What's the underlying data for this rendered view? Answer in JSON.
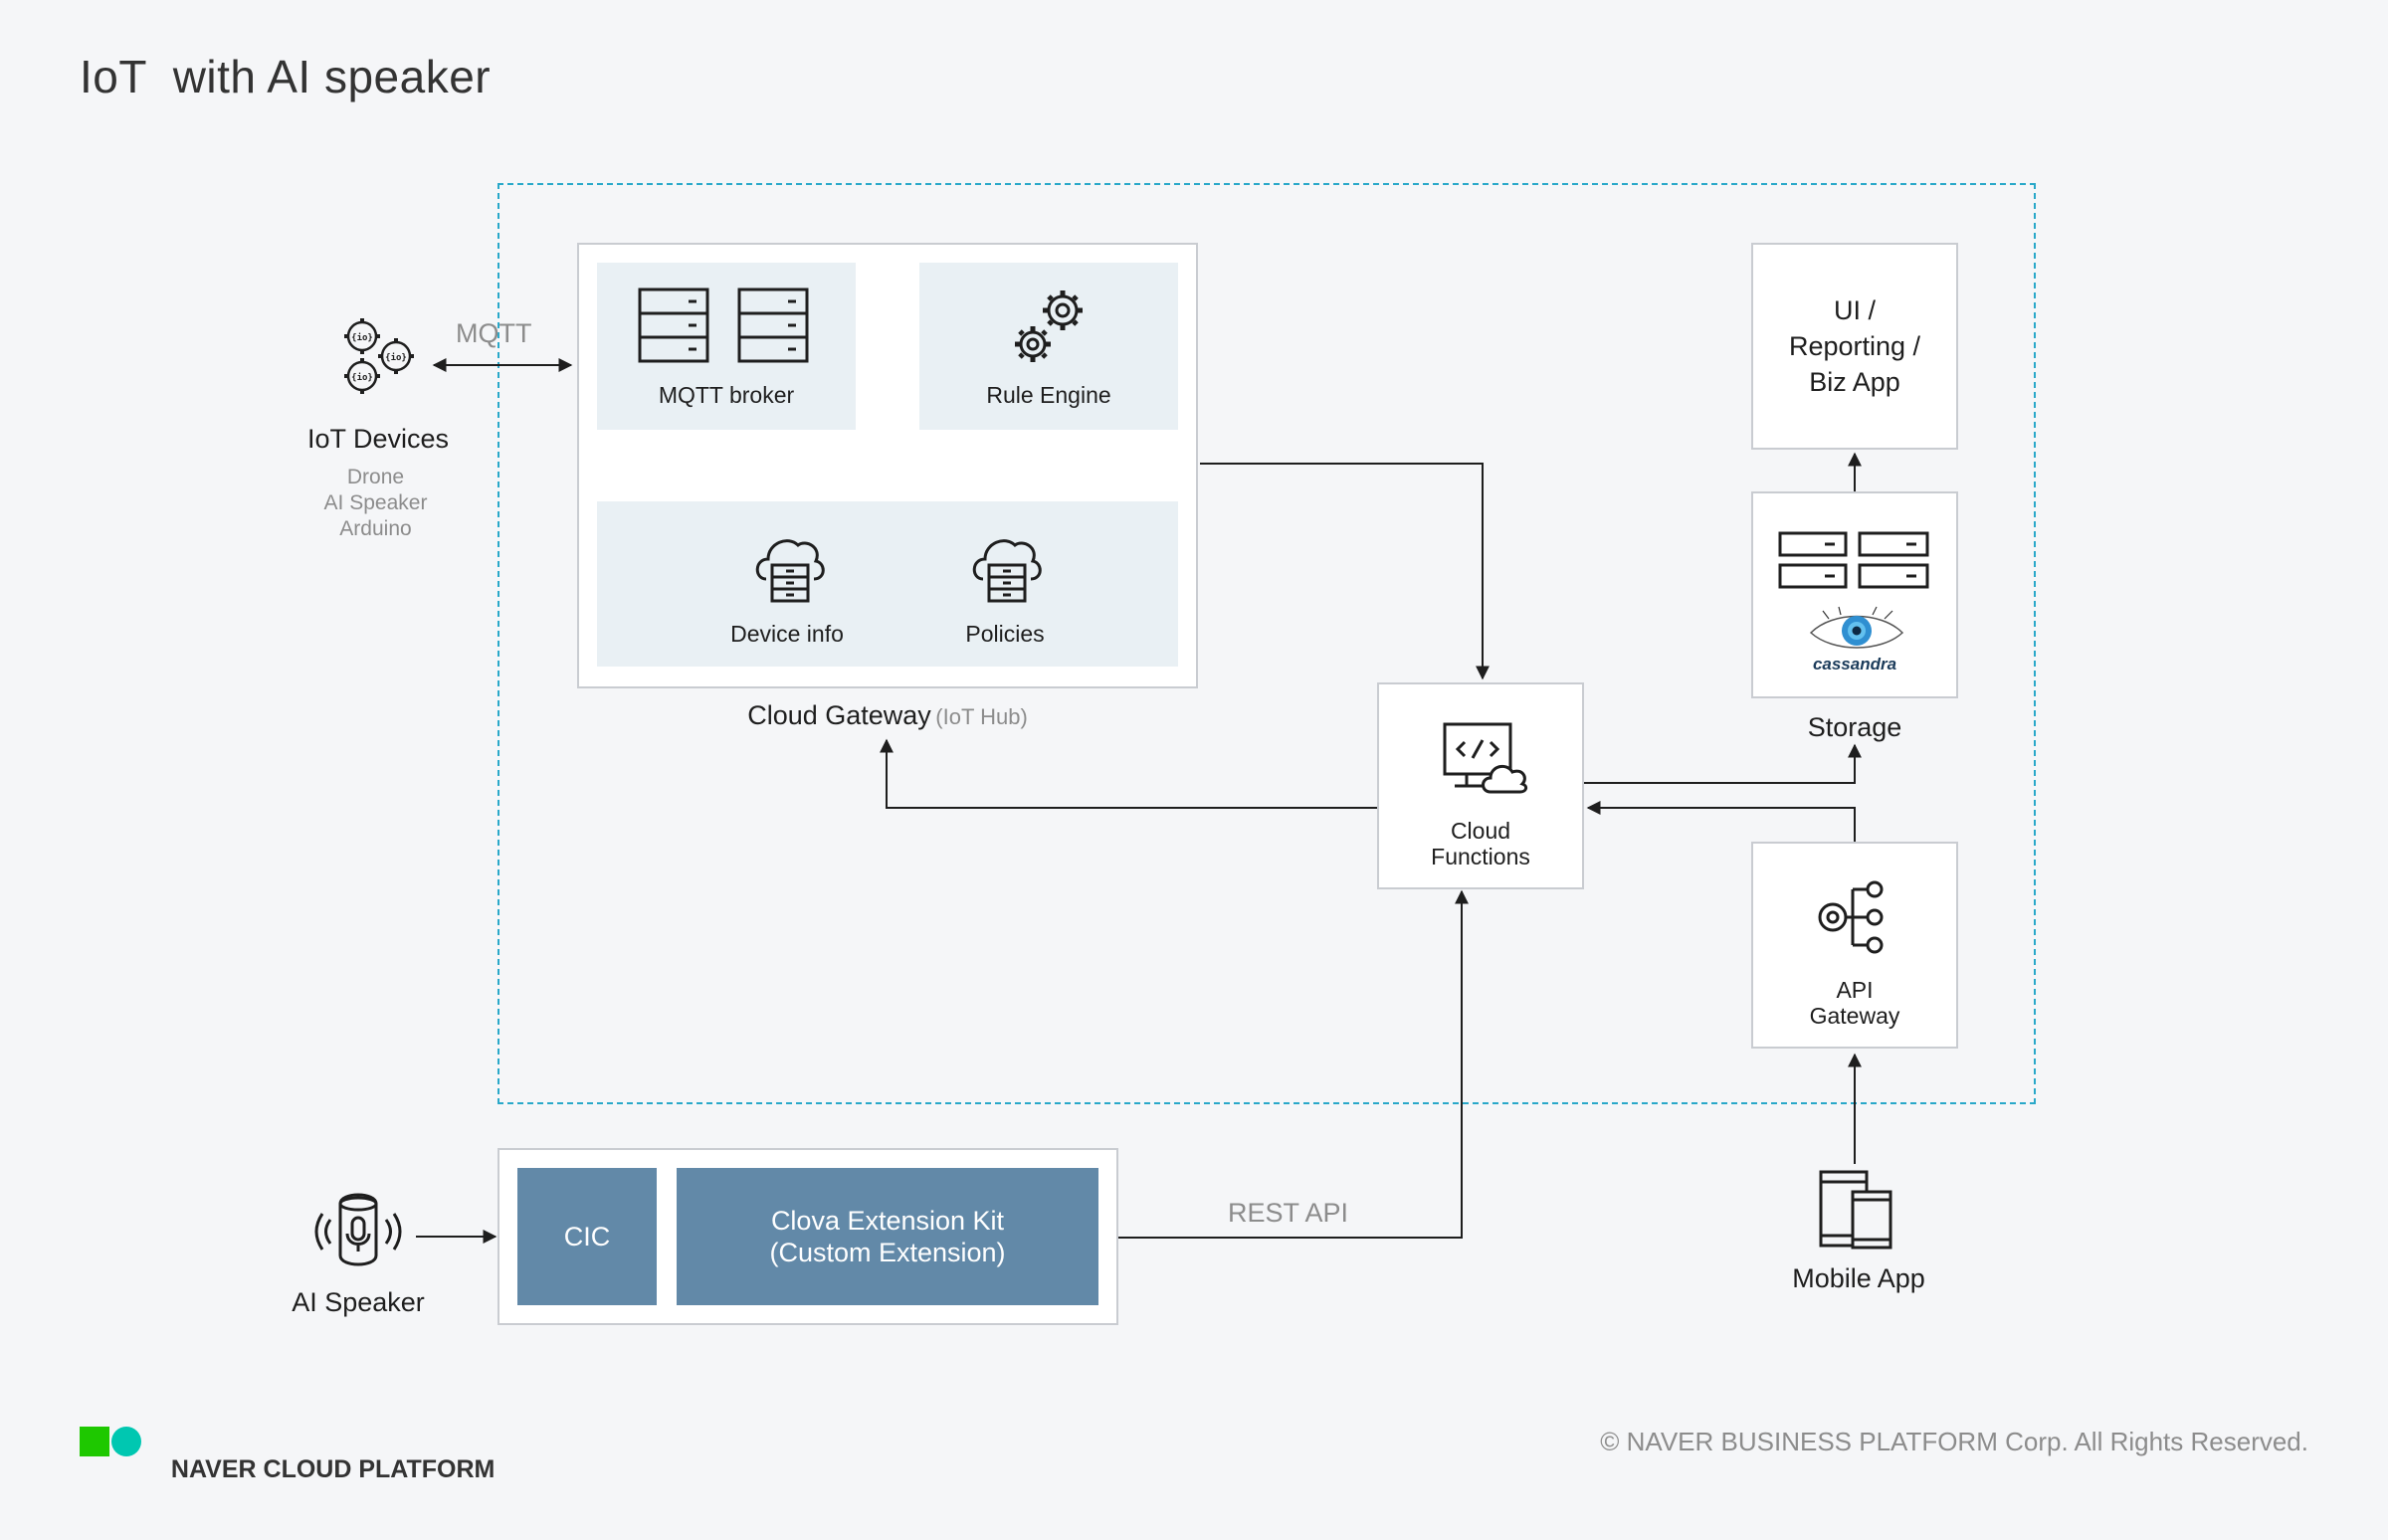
{
  "title": "IoT  with AI speaker",
  "cloud_gateway": {
    "label": "Cloud Gateway",
    "sub_label": "(IoT Hub)",
    "mqtt_broker": "MQTT broker",
    "rule_engine": "Rule Engine",
    "device_info": "Device info",
    "policies": "Policies"
  },
  "iot_devices": {
    "label": "IoT Devices",
    "items": [
      "Drone",
      "AI Speaker",
      "Arduino"
    ],
    "link_label": "MQTT"
  },
  "ui_box": {
    "lines": [
      "UI /",
      "Reporting /",
      "Biz App"
    ]
  },
  "storage": {
    "label": "Storage",
    "cassandra": "cassandra"
  },
  "cloud_functions": {
    "lines": [
      "Cloud",
      "Functions"
    ]
  },
  "api_gateway": {
    "lines": [
      "API",
      "Gateway"
    ]
  },
  "clova": {
    "cic": "CIC",
    "cek_line1": "Clova Extension Kit",
    "cek_line2": "(Custom Extension)"
  },
  "ai_speaker": {
    "label": "AI Speaker"
  },
  "rest_api_label": "REST API",
  "mobile_app": {
    "label": "Mobile App"
  },
  "footer": {
    "brand_bold": "NAVER",
    "brand_rest": " CLOUD PLATFORM",
    "copyright": "© NAVER BUSINESS PLATFORM Corp. All Rights Reserved."
  },
  "colors": {
    "dashed_border": "#29a8c9",
    "panel_bg": "#e9f0f4",
    "clova_block": "#6289a8",
    "logo_green": "#1ec800",
    "logo_teal": "#00c7b1"
  }
}
